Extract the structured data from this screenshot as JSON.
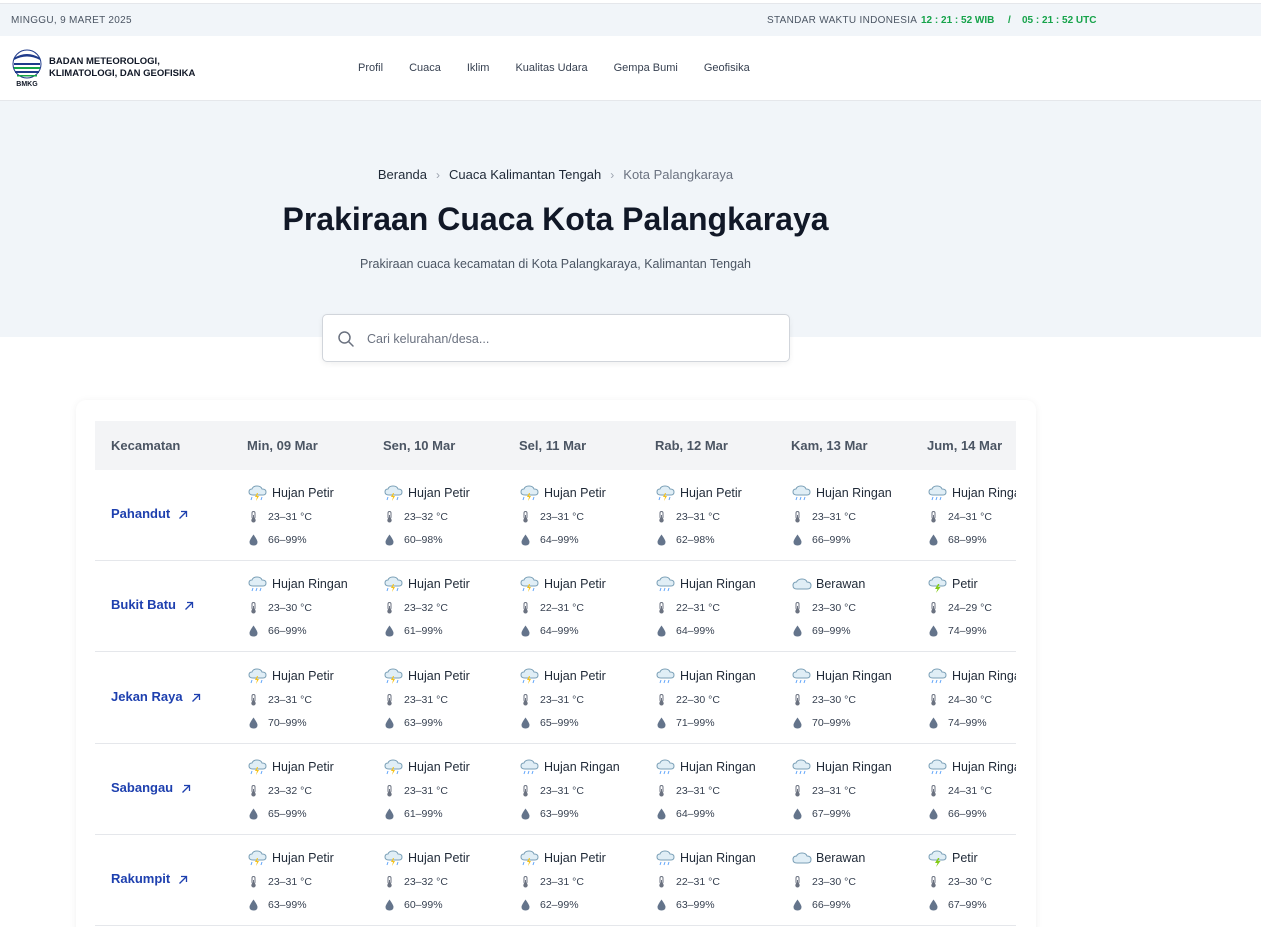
{
  "topbar": {
    "date": "MINGGU, 9 MARET 2025",
    "standard_label": "STANDAR WAKTU INDONESIA",
    "time_wib": "12 : 21 : 52 WIB",
    "separator": "/",
    "time_utc": "05 : 21 : 52 UTC"
  },
  "header": {
    "logo_text": "BMKG",
    "brand_line1": "BADAN METEOROLOGI,",
    "brand_line2": "KLIMATOLOGI, DAN GEOFISIKA",
    "nav": [
      "Profil",
      "Cuaca",
      "Iklim",
      "Kualitas Udara",
      "Gempa Bumi",
      "Geofisika"
    ]
  },
  "breadcrumb": [
    "Beranda",
    "Cuaca Kalimantan Tengah",
    "Kota Palangkaraya"
  ],
  "page_title": "Prakiraan Cuaca Kota Palangkaraya",
  "page_subtitle": "Prakiraan cuaca kecamatan di Kota Palangkaraya, Kalimantan Tengah",
  "search": {
    "placeholder": "Cari kelurahan/desa..."
  },
  "table": {
    "headers": [
      "Kecamatan",
      "Min, 09 Mar",
      "Sen, 10 Mar",
      "Sel, 11 Mar",
      "Rab, 12 Mar",
      "Kam, 13 Mar",
      "Jum, 14 Mar"
    ],
    "rows": [
      {
        "kecamatan": "Pahandut",
        "days": [
          {
            "cond": "Hujan Petir",
            "icon": "thunder-rain-icon",
            "temp": "23–31 °C",
            "hum": "66–99%"
          },
          {
            "cond": "Hujan Petir",
            "icon": "thunder-rain-icon",
            "temp": "23–32 °C",
            "hum": "60–98%"
          },
          {
            "cond": "Hujan Petir",
            "icon": "thunder-rain-icon",
            "temp": "23–31 °C",
            "hum": "64–99%"
          },
          {
            "cond": "Hujan Petir",
            "icon": "thunder-rain-icon",
            "temp": "23–31 °C",
            "hum": "62–98%"
          },
          {
            "cond": "Hujan Ringan",
            "icon": "light-rain-icon",
            "temp": "23–31 °C",
            "hum": "66–99%"
          },
          {
            "cond": "Hujan Ringan",
            "icon": "light-rain-icon",
            "temp": "24–31 °C",
            "hum": "68–99%"
          }
        ]
      },
      {
        "kecamatan": "Bukit Batu",
        "days": [
          {
            "cond": "Hujan Ringan",
            "icon": "light-rain-icon",
            "temp": "23–30 °C",
            "hum": "66–99%"
          },
          {
            "cond": "Hujan Petir",
            "icon": "thunder-rain-icon",
            "temp": "23–32 °C",
            "hum": "61–99%"
          },
          {
            "cond": "Hujan Petir",
            "icon": "thunder-rain-icon",
            "temp": "22–31 °C",
            "hum": "64–99%"
          },
          {
            "cond": "Hujan Ringan",
            "icon": "light-rain-icon",
            "temp": "22–31 °C",
            "hum": "64–99%"
          },
          {
            "cond": "Berawan",
            "icon": "cloud-icon",
            "temp": "23–30 °C",
            "hum": "69–99%"
          },
          {
            "cond": "Petir",
            "icon": "thunder-icon",
            "temp": "24–29 °C",
            "hum": "74–99%"
          }
        ]
      },
      {
        "kecamatan": "Jekan Raya",
        "days": [
          {
            "cond": "Hujan Petir",
            "icon": "thunder-rain-icon",
            "temp": "23–31 °C",
            "hum": "70–99%"
          },
          {
            "cond": "Hujan Petir",
            "icon": "thunder-rain-icon",
            "temp": "23–31 °C",
            "hum": "63–99%"
          },
          {
            "cond": "Hujan Petir",
            "icon": "thunder-rain-icon",
            "temp": "23–31 °C",
            "hum": "65–99%"
          },
          {
            "cond": "Hujan Ringan",
            "icon": "light-rain-icon",
            "temp": "22–30 °C",
            "hum": "71–99%"
          },
          {
            "cond": "Hujan Ringan",
            "icon": "light-rain-icon",
            "temp": "23–30 °C",
            "hum": "70–99%"
          },
          {
            "cond": "Hujan Ringan",
            "icon": "light-rain-icon",
            "temp": "24–30 °C",
            "hum": "74–99%"
          }
        ]
      },
      {
        "kecamatan": "Sabangau",
        "days": [
          {
            "cond": "Hujan Petir",
            "icon": "thunder-rain-icon",
            "temp": "23–32 °C",
            "hum": "65–99%"
          },
          {
            "cond": "Hujan Petir",
            "icon": "thunder-rain-icon",
            "temp": "23–31 °C",
            "hum": "61–99%"
          },
          {
            "cond": "Hujan Ringan",
            "icon": "light-rain-icon",
            "temp": "23–31 °C",
            "hum": "63–99%"
          },
          {
            "cond": "Hujan Ringan",
            "icon": "light-rain-icon",
            "temp": "23–31 °C",
            "hum": "64–99%"
          },
          {
            "cond": "Hujan Ringan",
            "icon": "light-rain-icon",
            "temp": "23–31 °C",
            "hum": "67–99%"
          },
          {
            "cond": "Hujan Ringan",
            "icon": "light-rain-icon",
            "temp": "24–31 °C",
            "hum": "66–99%"
          }
        ]
      },
      {
        "kecamatan": "Rakumpit",
        "days": [
          {
            "cond": "Hujan Petir",
            "icon": "thunder-rain-icon",
            "temp": "23–31 °C",
            "hum": "63–99%"
          },
          {
            "cond": "Hujan Petir",
            "icon": "thunder-rain-icon",
            "temp": "23–32 °C",
            "hum": "60–99%"
          },
          {
            "cond": "Hujan Petir",
            "icon": "thunder-rain-icon",
            "temp": "23–31 °C",
            "hum": "62–99%"
          },
          {
            "cond": "Hujan Ringan",
            "icon": "light-rain-icon",
            "temp": "22–31 °C",
            "hum": "63–99%"
          },
          {
            "cond": "Berawan",
            "icon": "cloud-icon",
            "temp": "23–30 °C",
            "hum": "66–99%"
          },
          {
            "cond": "Petir",
            "icon": "thunder-icon",
            "temp": "23–30 °C",
            "hum": "67–99%"
          }
        ]
      }
    ]
  },
  "colors": {
    "accent_green": "#16a34a",
    "link_blue": "#1e40af",
    "hero_bg": "#f1f5f9"
  }
}
